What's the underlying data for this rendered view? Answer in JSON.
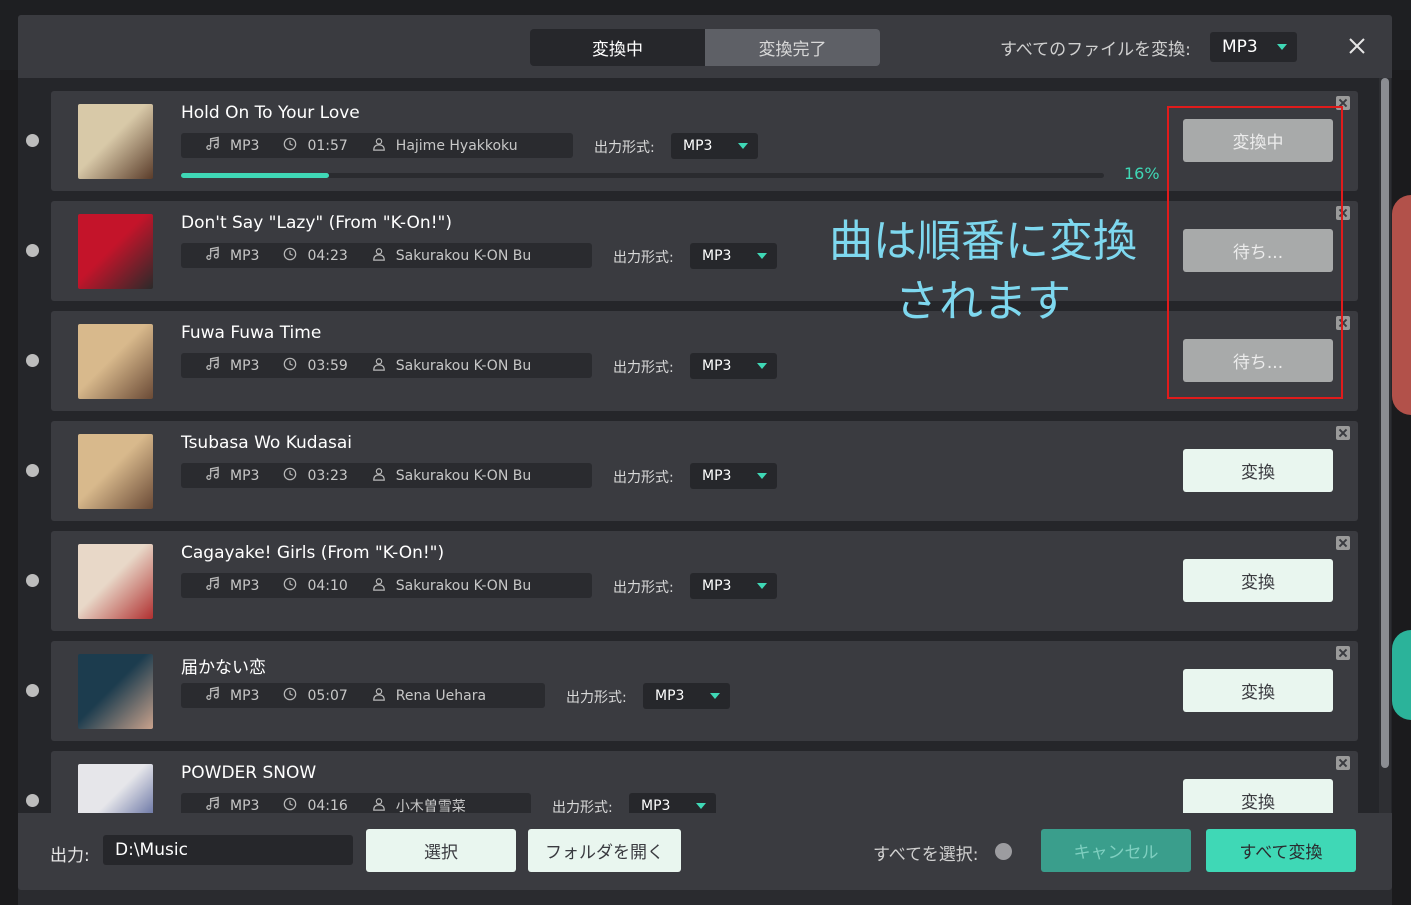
{
  "tabs": [
    {
      "label": "変換中",
      "active": true
    },
    {
      "label": "変換完了",
      "active": false
    }
  ],
  "header": {
    "convert_all_label": "すべてのファイルを変換:",
    "global_format": "MP3"
  },
  "format_label": "出力形式:",
  "tracks": [
    {
      "title": "Hold On To Your Love",
      "format": "MP3",
      "duration": "01:57",
      "artist": "Hajime Hyakkoku",
      "output_format": "MP3",
      "status": "変換中",
      "progress": 0.16,
      "progress_text": "16%",
      "thumb_colors": [
        "#d8c9a8",
        "#5a3c2a"
      ]
    },
    {
      "title": "Don't Say \"Lazy\" (From \"K-On!\")",
      "format": "MP3",
      "duration": "04:23",
      "artist": "Sakurakou K-ON Bu",
      "output_format": "MP3",
      "status": "待ち...",
      "thumb_colors": [
        "#c4142a",
        "#2a2a2a"
      ]
    },
    {
      "title": "Fuwa Fuwa Time",
      "format": "MP3",
      "duration": "03:59",
      "artist": "Sakurakou K-ON Bu",
      "output_format": "MP3",
      "status": "待ち...",
      "thumb_colors": [
        "#d8b98c",
        "#6a4a36"
      ]
    },
    {
      "title": "Tsubasa Wo Kudasai",
      "format": "MP3",
      "duration": "03:23",
      "artist": "Sakurakou K-ON Bu",
      "output_format": "MP3",
      "status": "変換",
      "thumb_colors": [
        "#d8b98c",
        "#6a4a36"
      ]
    },
    {
      "title": "Cagayake! Girls (From \"K-On!\")",
      "format": "MP3",
      "duration": "04:10",
      "artist": "Sakurakou K-ON Bu",
      "output_format": "MP3",
      "status": "変換",
      "thumb_colors": [
        "#e8d8c8",
        "#b03030"
      ]
    },
    {
      "title": "届かない恋",
      "format": "MP3",
      "duration": "05:07",
      "artist": "Rena Uehara",
      "output_format": "MP3",
      "status": "変換",
      "thumb_colors": [
        "#1c3c4e",
        "#c9a28c"
      ]
    },
    {
      "title": "POWDER SNOW",
      "format": "MP3",
      "duration": "04:16",
      "artist": "小木曽雪菜",
      "output_format": "MP3",
      "status": "変換",
      "thumb_colors": [
        "#e6e6ea",
        "#3a4a8a"
      ]
    }
  ],
  "annotation": {
    "line1": "曲は順番に変換",
    "line2": "されます"
  },
  "footer": {
    "output_label": "出力:",
    "output_path": "D:\\Music",
    "select_button": "選択",
    "open_folder_button": "フォルダを開く",
    "select_all_label": "すべてを選択:",
    "cancel_button": "キャンセル",
    "convert_all_button": "すべて変換"
  }
}
